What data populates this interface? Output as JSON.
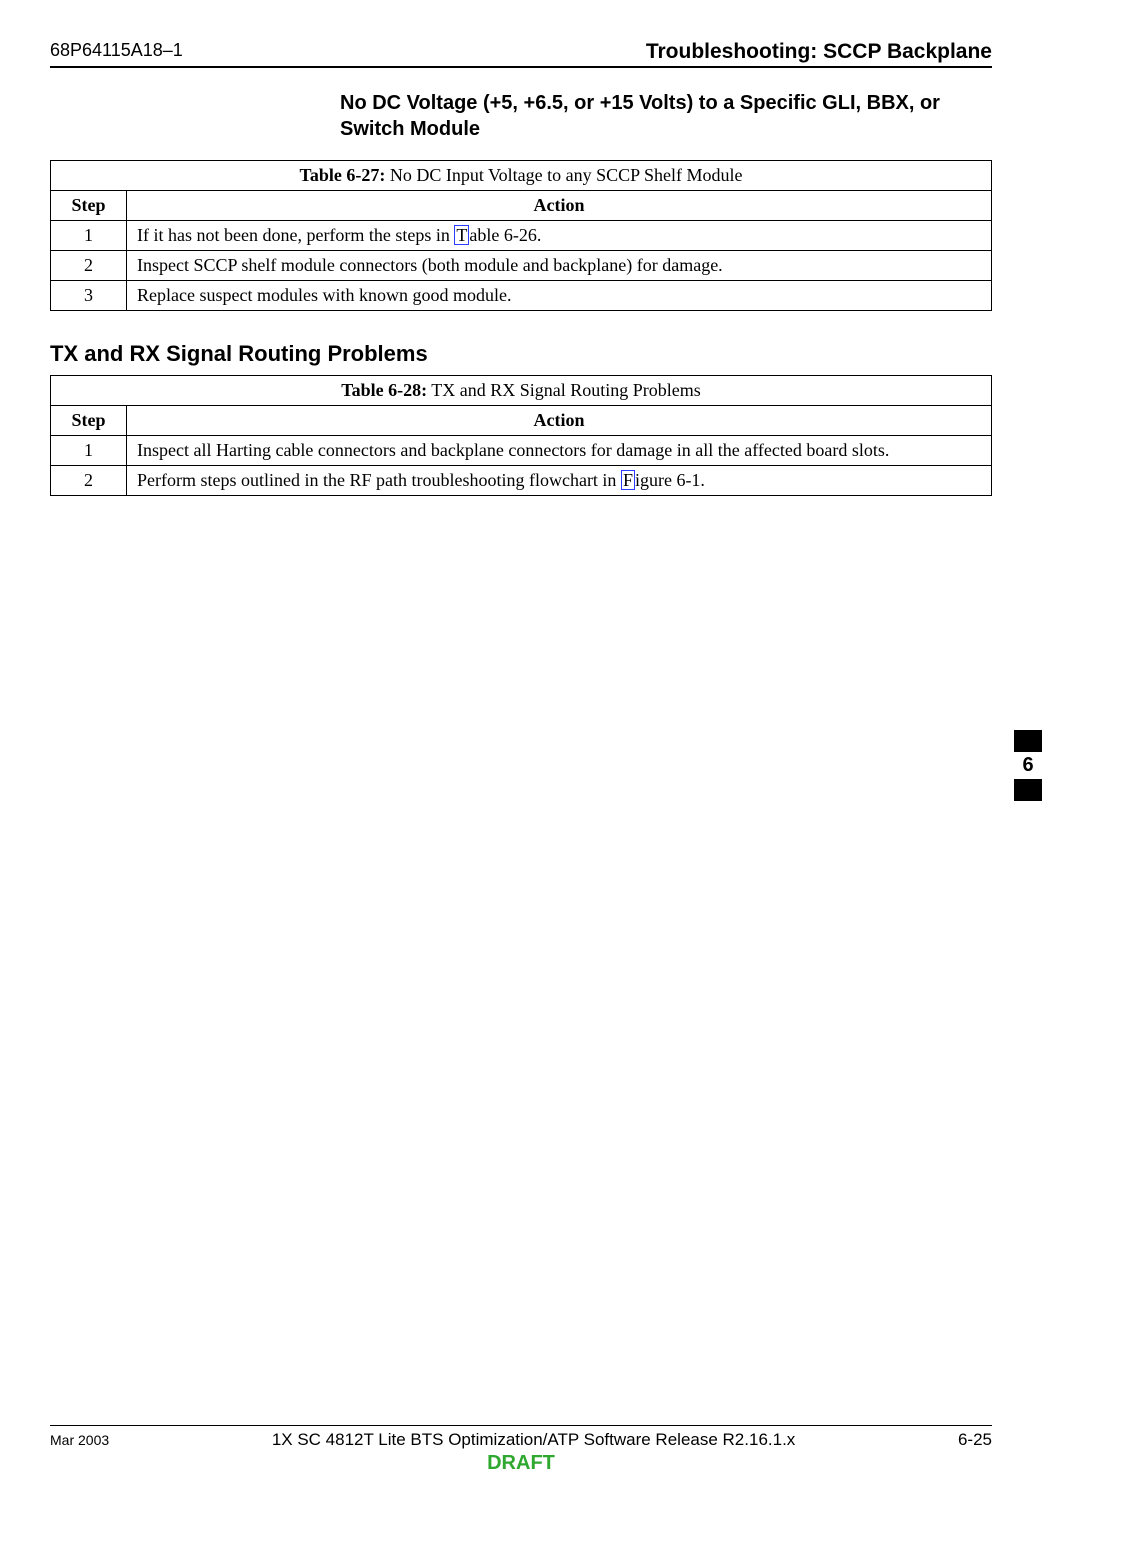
{
  "header": {
    "doc_id": "68P64115A18–1",
    "title": "Troubleshooting: SCCP Backplane"
  },
  "section1": {
    "heading": "No DC Voltage (+5, +6.5, or +15 Volts) to a Specific GLI, BBX, or Switch Module"
  },
  "table27": {
    "caption_bold": "Table 6-27:",
    "caption_rest": " No DC Input Voltage to any SCCP Shelf Module",
    "col_step": "Step",
    "col_action": "Action",
    "rows": [
      {
        "step": "1",
        "action_pre": "If it has not been done, perform the steps in ",
        "link": "T",
        "action_post": "able 6-26."
      },
      {
        "step": "2",
        "action": "Inspect SCCP shelf module connectors (both module and backplane) for damage."
      },
      {
        "step": "3",
        "action": "Replace suspect modules with known good module."
      }
    ]
  },
  "section2": {
    "heading": "TX and RX Signal Routing Problems"
  },
  "table28": {
    "caption_bold": "Table 6-28:",
    "caption_rest": " TX and RX Signal Routing Problems",
    "col_step": "Step",
    "col_action": "Action",
    "rows": [
      {
        "step": "1",
        "action": "Inspect all Harting cable connectors and backplane connectors for damage in all the affected board slots."
      },
      {
        "step": "2",
        "action_pre": "Perform steps outlined in the RF path troubleshooting flowchart in ",
        "link": "F",
        "action_post": "igure 6-1."
      }
    ]
  },
  "side_tab": "6",
  "footer": {
    "date": "Mar 2003",
    "center": "1X SC 4812T Lite BTS Optimization/ATP Software Release R2.16.1.x",
    "page": "6-25",
    "draft": "DRAFT"
  }
}
